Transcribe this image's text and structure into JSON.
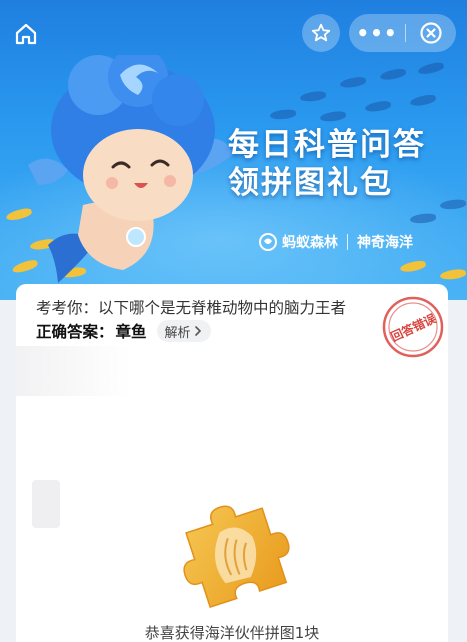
{
  "nav": {
    "home_icon": "home-icon",
    "favorite_icon": "star-icon",
    "more_label": "•••",
    "close_icon": "close-circle-icon"
  },
  "banner": {
    "title_line1": "每日科普问答",
    "title_line2": "领拼图礼包",
    "brand_primary": "蚂蚁森林",
    "brand_secondary": "神奇海洋",
    "colors": {
      "sky_top": "#1f7fe0",
      "sky_bottom": "#4bb3f4"
    }
  },
  "quiz": {
    "question": "考考你：以下哪个是无脊椎动物中的脑力王者",
    "answer_label": "正确答案：",
    "answer_value": "章鱼",
    "explain_label": "解析",
    "stamp_text": "回答错误",
    "stamp_color": "#d9453f"
  },
  "reward": {
    "text": "恭喜获得海洋伙伴拼图1块",
    "puzzle_color": "#f2b233"
  }
}
